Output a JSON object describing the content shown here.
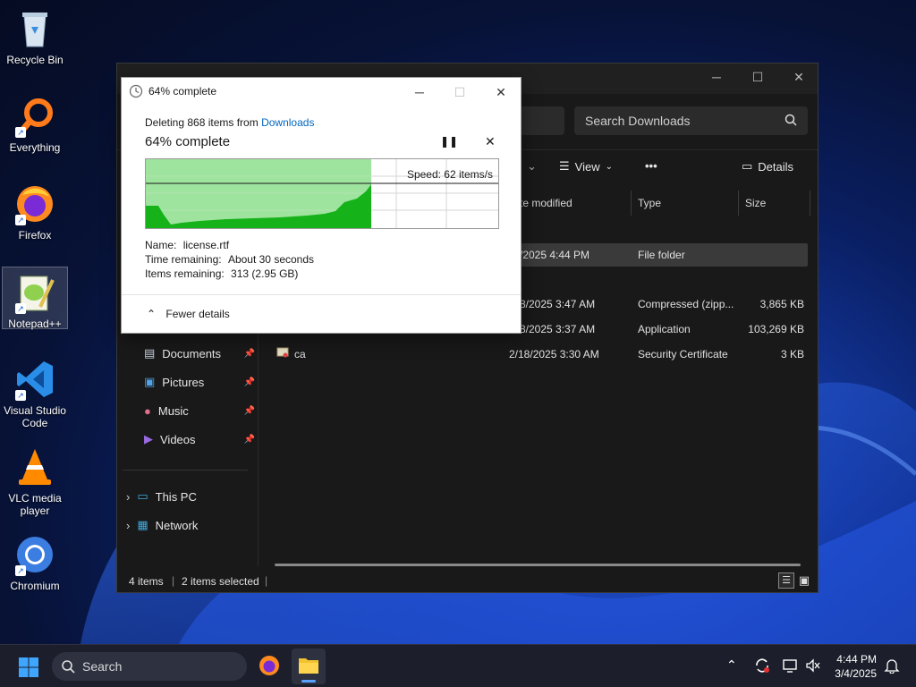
{
  "desktop": {
    "icons": [
      {
        "label": "Recycle Bin",
        "icon": "recycle-bin-icon"
      },
      {
        "label": "Everything",
        "icon": "everything-icon"
      },
      {
        "label": "Firefox",
        "icon": "firefox-icon"
      },
      {
        "label": "Notepad++",
        "icon": "notepad-plus-plus-icon"
      },
      {
        "label": "Visual Studio Code",
        "icon": "vscode-icon"
      },
      {
        "label": "VLC media player",
        "icon": "vlc-icon"
      },
      {
        "label": "Chromium",
        "icon": "chromium-icon"
      }
    ]
  },
  "explorer": {
    "search_placeholder": "Search Downloads",
    "toolbar": {
      "view_label": "View",
      "more_label": "•••",
      "details_label": "Details"
    },
    "columns": {
      "date": "te modified",
      "type": "Type",
      "size": "Size"
    },
    "rows": [
      {
        "name": "",
        "date": "/2025 4:44 PM",
        "type": "File folder",
        "size": "",
        "selected": true
      },
      {
        "name": "",
        "date": "8/2025 3:47 AM",
        "type": "Compressed (zipp...",
        "size": "3,865 KB"
      },
      {
        "name": "",
        "date": "8/2025 3:37 AM",
        "type": "Application",
        "size": "103,269 KB"
      },
      {
        "name": "ca",
        "date": "2/18/2025 3:30 AM",
        "type": "Security Certificate",
        "size": "3 KB"
      }
    ],
    "nav": [
      {
        "label": "Documents",
        "icon": "documents-icon"
      },
      {
        "label": "Pictures",
        "icon": "pictures-icon"
      },
      {
        "label": "Music",
        "icon": "music-icon"
      },
      {
        "label": "Videos",
        "icon": "videos-icon"
      },
      {
        "label": "This PC",
        "icon": "this-pc-icon"
      },
      {
        "label": "Network",
        "icon": "network-icon"
      }
    ],
    "status": {
      "items": "4 items",
      "selected": "2 items selected"
    }
  },
  "dialog": {
    "title": "64% complete",
    "deleting_prefix": "Deleting 868 items from",
    "deleting_link": "Downloads",
    "heading": "64% complete",
    "speed": "Speed: 62 items/s",
    "progress_fraction": 0.64,
    "name_label": "Name:",
    "name_value": "license.rtf",
    "time_label": "Time remaining:",
    "time_value": "About 30 seconds",
    "items_label": "Items remaining:",
    "items_value": "313 (2.95 GB)",
    "fewer_details": "Fewer details"
  },
  "taskbar": {
    "search_placeholder": "Search",
    "time": "4:44 PM",
    "date": "3/4/2025"
  },
  "colors": {
    "progress_fill": "#9ee39e",
    "progress_graph": "#16b21a",
    "link": "#0067c0"
  }
}
